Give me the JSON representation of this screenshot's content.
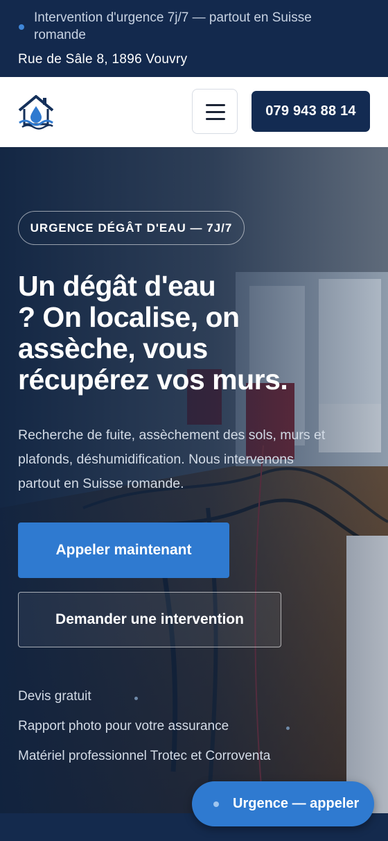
{
  "topbar": {
    "notice": "Intervention d'urgence 7j/7 — partout en Suisse romande",
    "address": "Rue de Sâle 8, 1896 Vouvry"
  },
  "navbar": {
    "logo_icon": "house-water-drop-icon",
    "menu_icon": "hamburger-menu-icon",
    "phone": "079 943 88 14"
  },
  "hero": {
    "badge": "URGENCE DÉGÂT D'EAU — 7J/7",
    "headline_lines": [
      "Un dégât d'eau",
      "? On localise, on",
      "assèche, vous",
      "récupérez vos murs."
    ],
    "lead_lines": [
      "Recherche de fuite, assèchement des sols, murs et",
      "plafonds, déshumidification. Nous intervenons",
      "partout en Suisse romande."
    ],
    "cta_primary": "Appeler maintenant",
    "cta_secondary": "Demander une intervention",
    "perks": [
      "Devis gratuit",
      "Rapport photo pour votre assurance",
      "Matériel professionnel Trotec et Corroventa"
    ]
  },
  "sticky": {
    "label": "Urgence — appeler"
  },
  "colors": {
    "navy": "#13294d",
    "accent_blue": "#2f7ad0",
    "white": "#ffffff"
  }
}
